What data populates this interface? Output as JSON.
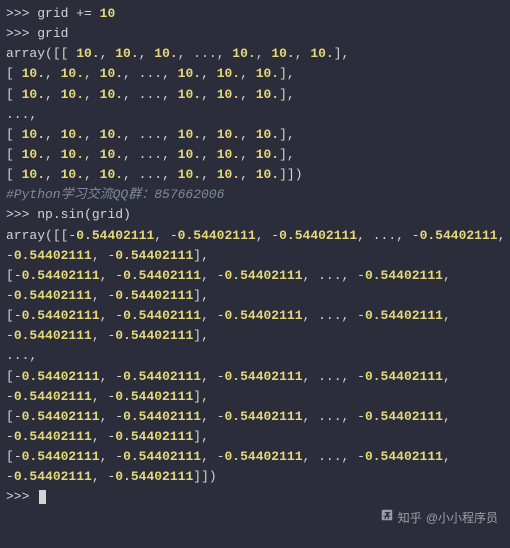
{
  "lines": [
    {
      "type": "prompt",
      "segments": [
        {
          "t": "prompt",
          "v": ">>> "
        },
        {
          "t": "var",
          "v": "grid "
        },
        {
          "t": "op",
          "v": "+= "
        },
        {
          "t": "num",
          "v": "10"
        }
      ]
    },
    {
      "type": "prompt",
      "segments": [
        {
          "t": "prompt",
          "v": ">>> "
        },
        {
          "t": "var",
          "v": "grid"
        }
      ]
    },
    {
      "type": "out",
      "segments": [
        {
          "t": "func",
          "v": "array"
        },
        {
          "t": "paren",
          "v": "([[ "
        },
        {
          "t": "num",
          "v": "10."
        },
        {
          "t": "paren",
          "v": ", "
        },
        {
          "t": "num",
          "v": "10."
        },
        {
          "t": "paren",
          "v": ", "
        },
        {
          "t": "num",
          "v": "10."
        },
        {
          "t": "paren",
          "v": ", "
        },
        {
          "t": "ellipsis",
          "v": "..."
        },
        {
          "t": "paren",
          "v": ", "
        },
        {
          "t": "num",
          "v": "10."
        },
        {
          "t": "paren",
          "v": ", "
        },
        {
          "t": "num",
          "v": "10."
        },
        {
          "t": "paren",
          "v": ", "
        },
        {
          "t": "num",
          "v": "10."
        },
        {
          "t": "paren",
          "v": "],"
        }
      ]
    },
    {
      "type": "out",
      "segments": [
        {
          "t": "paren",
          "v": "[ "
        },
        {
          "t": "num",
          "v": "10."
        },
        {
          "t": "paren",
          "v": ", "
        },
        {
          "t": "num",
          "v": "10."
        },
        {
          "t": "paren",
          "v": ", "
        },
        {
          "t": "num",
          "v": "10."
        },
        {
          "t": "paren",
          "v": ", "
        },
        {
          "t": "ellipsis",
          "v": "..."
        },
        {
          "t": "paren",
          "v": ", "
        },
        {
          "t": "num",
          "v": "10."
        },
        {
          "t": "paren",
          "v": ", "
        },
        {
          "t": "num",
          "v": "10."
        },
        {
          "t": "paren",
          "v": ", "
        },
        {
          "t": "num",
          "v": "10."
        },
        {
          "t": "paren",
          "v": "],"
        }
      ]
    },
    {
      "type": "out",
      "segments": [
        {
          "t": "paren",
          "v": "[ "
        },
        {
          "t": "num",
          "v": "10."
        },
        {
          "t": "paren",
          "v": ", "
        },
        {
          "t": "num",
          "v": "10."
        },
        {
          "t": "paren",
          "v": ", "
        },
        {
          "t": "num",
          "v": "10."
        },
        {
          "t": "paren",
          "v": ", "
        },
        {
          "t": "ellipsis",
          "v": "..."
        },
        {
          "t": "paren",
          "v": ", "
        },
        {
          "t": "num",
          "v": "10."
        },
        {
          "t": "paren",
          "v": ", "
        },
        {
          "t": "num",
          "v": "10."
        },
        {
          "t": "paren",
          "v": ", "
        },
        {
          "t": "num",
          "v": "10."
        },
        {
          "t": "paren",
          "v": "],"
        }
      ]
    },
    {
      "type": "out",
      "segments": [
        {
          "t": "ellipsis",
          "v": "...,"
        }
      ]
    },
    {
      "type": "out",
      "segments": [
        {
          "t": "paren",
          "v": "[ "
        },
        {
          "t": "num",
          "v": "10."
        },
        {
          "t": "paren",
          "v": ", "
        },
        {
          "t": "num",
          "v": "10."
        },
        {
          "t": "paren",
          "v": ", "
        },
        {
          "t": "num",
          "v": "10."
        },
        {
          "t": "paren",
          "v": ", "
        },
        {
          "t": "ellipsis",
          "v": "..."
        },
        {
          "t": "paren",
          "v": ", "
        },
        {
          "t": "num",
          "v": "10."
        },
        {
          "t": "paren",
          "v": ", "
        },
        {
          "t": "num",
          "v": "10."
        },
        {
          "t": "paren",
          "v": ", "
        },
        {
          "t": "num",
          "v": "10."
        },
        {
          "t": "paren",
          "v": "],"
        }
      ]
    },
    {
      "type": "out",
      "segments": [
        {
          "t": "paren",
          "v": "[ "
        },
        {
          "t": "num",
          "v": "10."
        },
        {
          "t": "paren",
          "v": ", "
        },
        {
          "t": "num",
          "v": "10."
        },
        {
          "t": "paren",
          "v": ", "
        },
        {
          "t": "num",
          "v": "10."
        },
        {
          "t": "paren",
          "v": ", "
        },
        {
          "t": "ellipsis",
          "v": "..."
        },
        {
          "t": "paren",
          "v": ", "
        },
        {
          "t": "num",
          "v": "10."
        },
        {
          "t": "paren",
          "v": ", "
        },
        {
          "t": "num",
          "v": "10."
        },
        {
          "t": "paren",
          "v": ", "
        },
        {
          "t": "num",
          "v": "10."
        },
        {
          "t": "paren",
          "v": "],"
        }
      ]
    },
    {
      "type": "out",
      "segments": [
        {
          "t": "paren",
          "v": "[ "
        },
        {
          "t": "num",
          "v": "10."
        },
        {
          "t": "paren",
          "v": ", "
        },
        {
          "t": "num",
          "v": "10."
        },
        {
          "t": "paren",
          "v": ", "
        },
        {
          "t": "num",
          "v": "10."
        },
        {
          "t": "paren",
          "v": ", "
        },
        {
          "t": "ellipsis",
          "v": "..."
        },
        {
          "t": "paren",
          "v": ", "
        },
        {
          "t": "num",
          "v": "10."
        },
        {
          "t": "paren",
          "v": ", "
        },
        {
          "t": "num",
          "v": "10."
        },
        {
          "t": "paren",
          "v": ", "
        },
        {
          "t": "num",
          "v": "10."
        },
        {
          "t": "paren",
          "v": "]])"
        }
      ]
    },
    {
      "type": "out",
      "segments": [
        {
          "t": "comment",
          "v": "#Python学习交流QQ群：857662006"
        }
      ]
    },
    {
      "type": "prompt",
      "segments": [
        {
          "t": "prompt",
          "v": ">>> "
        },
        {
          "t": "var",
          "v": "np"
        },
        {
          "t": "op",
          "v": "."
        },
        {
          "t": "var",
          "v": "sin"
        },
        {
          "t": "paren",
          "v": "("
        },
        {
          "t": "var",
          "v": "grid"
        },
        {
          "t": "paren",
          "v": ")"
        }
      ]
    },
    {
      "type": "out",
      "segments": [
        {
          "t": "func",
          "v": "array"
        },
        {
          "t": "paren",
          "v": "([["
        },
        {
          "t": "op",
          "v": "-"
        },
        {
          "t": "num",
          "v": "0.54402111"
        },
        {
          "t": "paren",
          "v": ", "
        },
        {
          "t": "op",
          "v": "-"
        },
        {
          "t": "num",
          "v": "0.54402111"
        },
        {
          "t": "paren",
          "v": ", "
        },
        {
          "t": "op",
          "v": "-"
        },
        {
          "t": "num",
          "v": "0.54402111"
        },
        {
          "t": "paren",
          "v": ", "
        },
        {
          "t": "ellipsis",
          "v": "..."
        },
        {
          "t": "paren",
          "v": ", "
        },
        {
          "t": "op",
          "v": "-"
        },
        {
          "t": "num",
          "v": "0.54402111"
        },
        {
          "t": "paren",
          "v": ","
        }
      ]
    },
    {
      "type": "out",
      "segments": [
        {
          "t": "op",
          "v": "-"
        },
        {
          "t": "num",
          "v": "0.54402111"
        },
        {
          "t": "paren",
          "v": ", "
        },
        {
          "t": "op",
          "v": "-"
        },
        {
          "t": "num",
          "v": "0.54402111"
        },
        {
          "t": "paren",
          "v": "],"
        }
      ]
    },
    {
      "type": "out",
      "segments": [
        {
          "t": "paren",
          "v": "["
        },
        {
          "t": "op",
          "v": "-"
        },
        {
          "t": "num",
          "v": "0.54402111"
        },
        {
          "t": "paren",
          "v": ", "
        },
        {
          "t": "op",
          "v": "-"
        },
        {
          "t": "num",
          "v": "0.54402111"
        },
        {
          "t": "paren",
          "v": ", "
        },
        {
          "t": "op",
          "v": "-"
        },
        {
          "t": "num",
          "v": "0.54402111"
        },
        {
          "t": "paren",
          "v": ", "
        },
        {
          "t": "ellipsis",
          "v": "..."
        },
        {
          "t": "paren",
          "v": ", "
        },
        {
          "t": "op",
          "v": "-"
        },
        {
          "t": "num",
          "v": "0.54402111"
        },
        {
          "t": "paren",
          "v": ","
        }
      ]
    },
    {
      "type": "out",
      "segments": [
        {
          "t": "op",
          "v": "-"
        },
        {
          "t": "num",
          "v": "0.54402111"
        },
        {
          "t": "paren",
          "v": ", "
        },
        {
          "t": "op",
          "v": "-"
        },
        {
          "t": "num",
          "v": "0.54402111"
        },
        {
          "t": "paren",
          "v": "],"
        }
      ]
    },
    {
      "type": "out",
      "segments": [
        {
          "t": "paren",
          "v": "["
        },
        {
          "t": "op",
          "v": "-"
        },
        {
          "t": "num",
          "v": "0.54402111"
        },
        {
          "t": "paren",
          "v": ", "
        },
        {
          "t": "op",
          "v": "-"
        },
        {
          "t": "num",
          "v": "0.54402111"
        },
        {
          "t": "paren",
          "v": ", "
        },
        {
          "t": "op",
          "v": "-"
        },
        {
          "t": "num",
          "v": "0.54402111"
        },
        {
          "t": "paren",
          "v": ", "
        },
        {
          "t": "ellipsis",
          "v": "..."
        },
        {
          "t": "paren",
          "v": ", "
        },
        {
          "t": "op",
          "v": "-"
        },
        {
          "t": "num",
          "v": "0.54402111"
        },
        {
          "t": "paren",
          "v": ","
        }
      ]
    },
    {
      "type": "out",
      "segments": [
        {
          "t": "op",
          "v": "-"
        },
        {
          "t": "num",
          "v": "0.54402111"
        },
        {
          "t": "paren",
          "v": ", "
        },
        {
          "t": "op",
          "v": "-"
        },
        {
          "t": "num",
          "v": "0.54402111"
        },
        {
          "t": "paren",
          "v": "],"
        }
      ]
    },
    {
      "type": "out",
      "segments": [
        {
          "t": "ellipsis",
          "v": "...,"
        }
      ]
    },
    {
      "type": "out",
      "segments": [
        {
          "t": "paren",
          "v": "["
        },
        {
          "t": "op",
          "v": "-"
        },
        {
          "t": "num",
          "v": "0.54402111"
        },
        {
          "t": "paren",
          "v": ", "
        },
        {
          "t": "op",
          "v": "-"
        },
        {
          "t": "num",
          "v": "0.54402111"
        },
        {
          "t": "paren",
          "v": ", "
        },
        {
          "t": "op",
          "v": "-"
        },
        {
          "t": "num",
          "v": "0.54402111"
        },
        {
          "t": "paren",
          "v": ", "
        },
        {
          "t": "ellipsis",
          "v": "..."
        },
        {
          "t": "paren",
          "v": ", "
        },
        {
          "t": "op",
          "v": "-"
        },
        {
          "t": "num",
          "v": "0.54402111"
        },
        {
          "t": "paren",
          "v": ","
        }
      ]
    },
    {
      "type": "out",
      "segments": [
        {
          "t": "op",
          "v": "-"
        },
        {
          "t": "num",
          "v": "0.54402111"
        },
        {
          "t": "paren",
          "v": ", "
        },
        {
          "t": "op",
          "v": "-"
        },
        {
          "t": "num",
          "v": "0.54402111"
        },
        {
          "t": "paren",
          "v": "],"
        }
      ]
    },
    {
      "type": "out",
      "segments": [
        {
          "t": "paren",
          "v": "["
        },
        {
          "t": "op",
          "v": "-"
        },
        {
          "t": "num",
          "v": "0.54402111"
        },
        {
          "t": "paren",
          "v": ", "
        },
        {
          "t": "op",
          "v": "-"
        },
        {
          "t": "num",
          "v": "0.54402111"
        },
        {
          "t": "paren",
          "v": ", "
        },
        {
          "t": "op",
          "v": "-"
        },
        {
          "t": "num",
          "v": "0.54402111"
        },
        {
          "t": "paren",
          "v": ", "
        },
        {
          "t": "ellipsis",
          "v": "..."
        },
        {
          "t": "paren",
          "v": ", "
        },
        {
          "t": "op",
          "v": "-"
        },
        {
          "t": "num",
          "v": "0.54402111"
        },
        {
          "t": "paren",
          "v": ","
        }
      ]
    },
    {
      "type": "out",
      "segments": [
        {
          "t": "op",
          "v": "-"
        },
        {
          "t": "num",
          "v": "0.54402111"
        },
        {
          "t": "paren",
          "v": ", "
        },
        {
          "t": "op",
          "v": "-"
        },
        {
          "t": "num",
          "v": "0.54402111"
        },
        {
          "t": "paren",
          "v": "],"
        }
      ]
    },
    {
      "type": "out",
      "segments": [
        {
          "t": "paren",
          "v": "["
        },
        {
          "t": "op",
          "v": "-"
        },
        {
          "t": "num",
          "v": "0.54402111"
        },
        {
          "t": "paren",
          "v": ", "
        },
        {
          "t": "op",
          "v": "-"
        },
        {
          "t": "num",
          "v": "0.54402111"
        },
        {
          "t": "paren",
          "v": ", "
        },
        {
          "t": "op",
          "v": "-"
        },
        {
          "t": "num",
          "v": "0.54402111"
        },
        {
          "t": "paren",
          "v": ", "
        },
        {
          "t": "ellipsis",
          "v": "..."
        },
        {
          "t": "paren",
          "v": ", "
        },
        {
          "t": "op",
          "v": "-"
        },
        {
          "t": "num",
          "v": "0.54402111"
        },
        {
          "t": "paren",
          "v": ","
        }
      ]
    },
    {
      "type": "out",
      "segments": [
        {
          "t": "op",
          "v": "-"
        },
        {
          "t": "num",
          "v": "0.54402111"
        },
        {
          "t": "paren",
          "v": ", "
        },
        {
          "t": "op",
          "v": "-"
        },
        {
          "t": "num",
          "v": "0.54402111"
        },
        {
          "t": "paren",
          "v": "]])"
        }
      ]
    }
  ],
  "final_prompt": ">>> ",
  "watermark": {
    "prefix": "知乎",
    "author": "@小小程序员"
  }
}
